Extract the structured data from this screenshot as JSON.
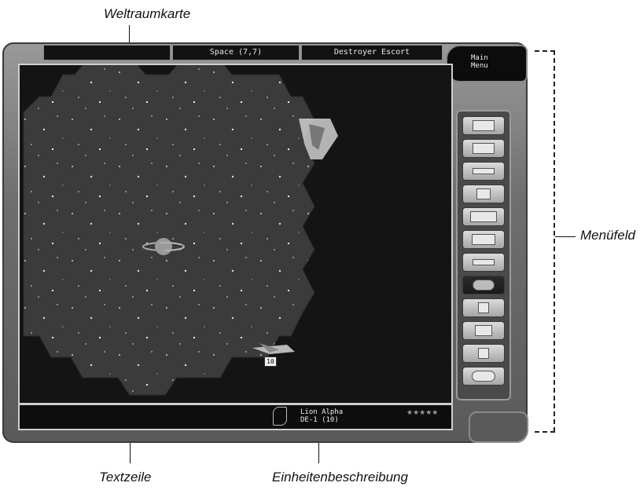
{
  "callouts": {
    "top": "Weltraumkarte",
    "right": "Menüfeld",
    "bottom_left": "Textzeile",
    "bottom_right": "Einheitenbeschreibung"
  },
  "header": {
    "left_tab": "",
    "coords": "Space (7,7)",
    "unit_type": "Destroyer Escort"
  },
  "main_menu": {
    "line1": "Main",
    "line2": "Menu"
  },
  "menu_buttons": [
    {
      "icon": "list-icon"
    },
    {
      "icon": "grid-icon"
    },
    {
      "icon": "ship-icon"
    },
    {
      "icon": "hexagon-icon"
    },
    {
      "icon": "monitor-compare-icon"
    },
    {
      "icon": "arrow-left-icon"
    },
    {
      "icon": "fighter-icon"
    },
    {
      "icon": "group-icon"
    },
    {
      "icon": "check-icon"
    },
    {
      "icon": "computer-icon"
    },
    {
      "icon": "money-icon"
    },
    {
      "icon": "cycle-icon"
    }
  ],
  "map": {
    "planet_label": "",
    "unit_count": "10"
  },
  "status": {
    "text_line": "",
    "unit_name": "Lion Alpha",
    "unit_id": "DE-1 (10)",
    "stars": "★★★★★"
  },
  "colors": {
    "frame": "#6e6e6e",
    "map_bg": "#141414",
    "hex_fill": "#3b3b3b",
    "text": "#e8e8e8"
  }
}
